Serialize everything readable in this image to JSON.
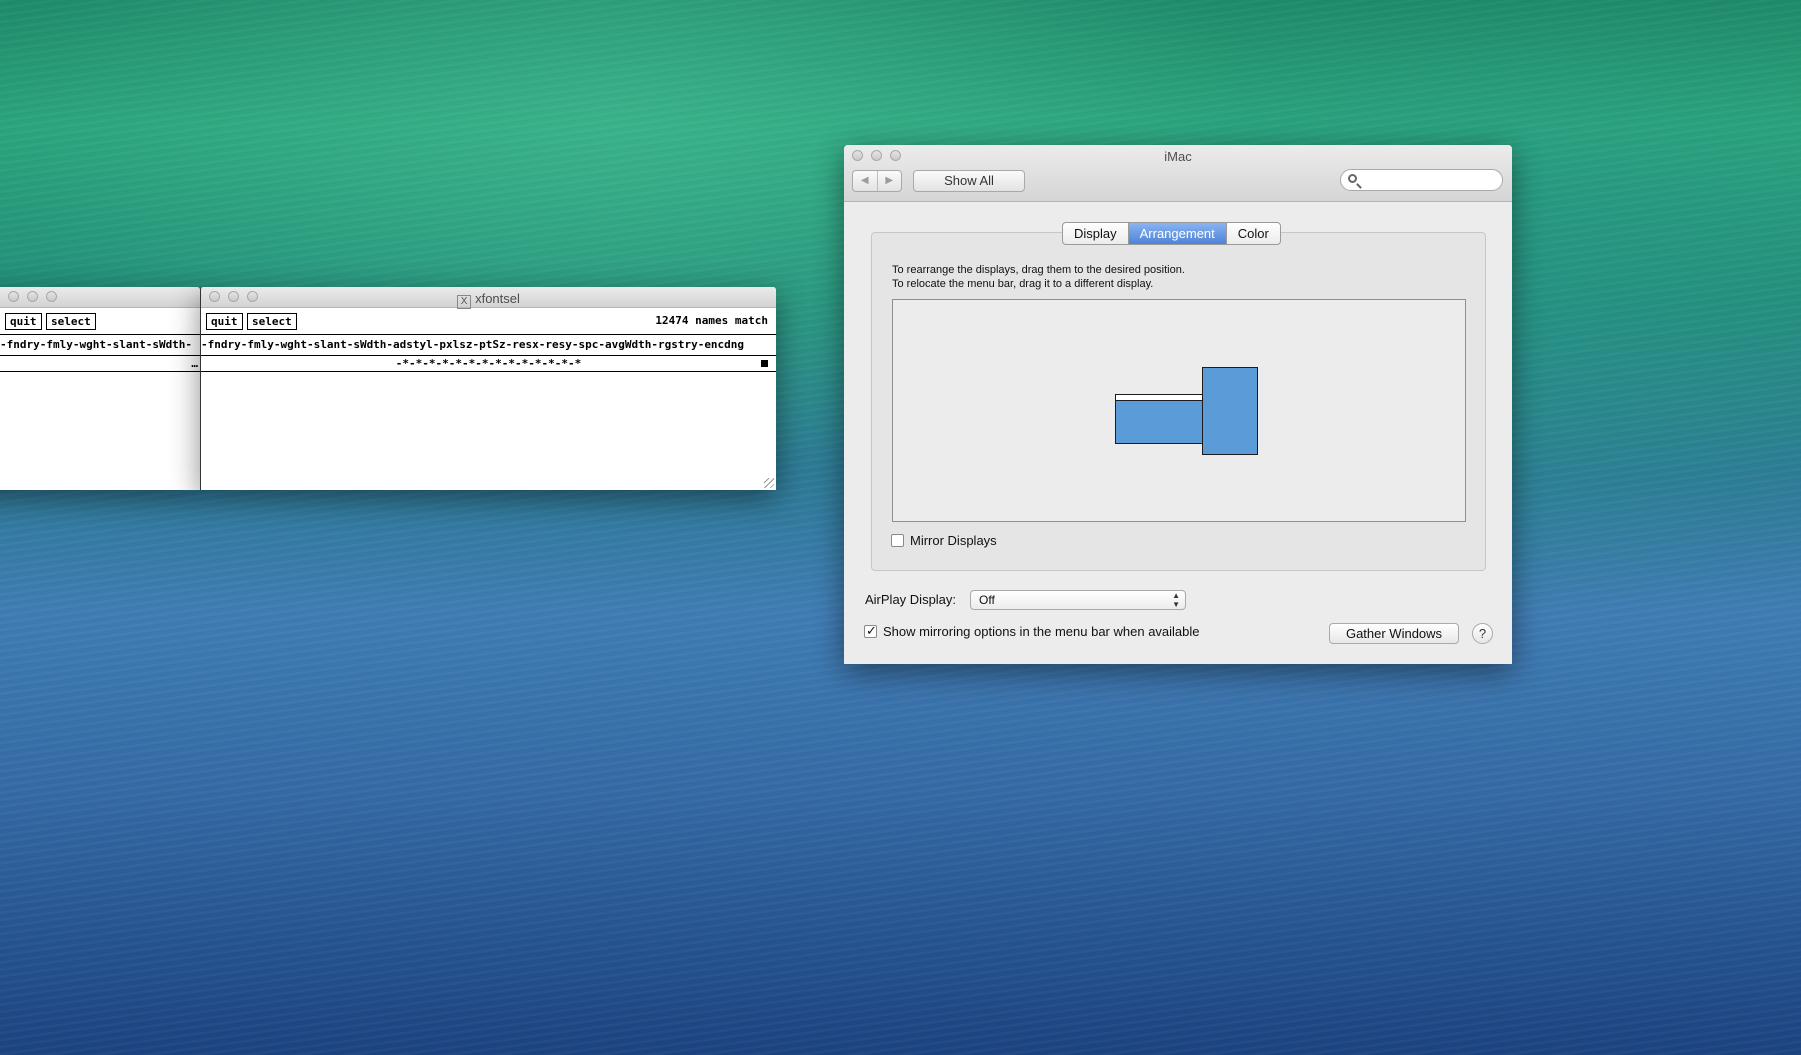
{
  "xfontsel_left": {
    "quit_label": "quit",
    "select_label": "select",
    "fields": "-fndry-fmly-wght-slant-sWdth-",
    "pattern": "…"
  },
  "xfontsel_main": {
    "title": "xfontsel",
    "title_icon": "x-window-icon",
    "quit_label": "quit",
    "select_label": "select",
    "match_count": "12474 names match",
    "fields": "-fndry-fmly-wght-slant-sWdth-adstyl-pxlsz-ptSz-resx-resy-spc-avgWdth-rgstry-encdng",
    "pattern": "-*-*-*-*-*-*-*-*-*-*-*-*-*-*"
  },
  "prefs": {
    "title": "iMac",
    "nav_back": "◀",
    "nav_forward": "▶",
    "show_all_label": "Show All",
    "search_placeholder": "",
    "tabs": [
      {
        "label": "Display",
        "active": false
      },
      {
        "label": "Arrangement",
        "active": true
      },
      {
        "label": "Color",
        "active": false
      }
    ],
    "instructions_line1": "To rearrange the displays, drag them to the desired position.",
    "instructions_line2": "To relocate the menu bar, drag it to a different display.",
    "mirror_label": "Mirror Displays",
    "mirror_checked": false,
    "airplay_label": "AirPlay Display:",
    "airplay_value": "Off",
    "show_mirroring_label": "Show mirroring options in the menu bar when available",
    "show_mirroring_checked": true,
    "gather_label": "Gather Windows",
    "help_label": "?",
    "display_color": "#5b9bd8",
    "accent_color": "#4d83d8"
  }
}
